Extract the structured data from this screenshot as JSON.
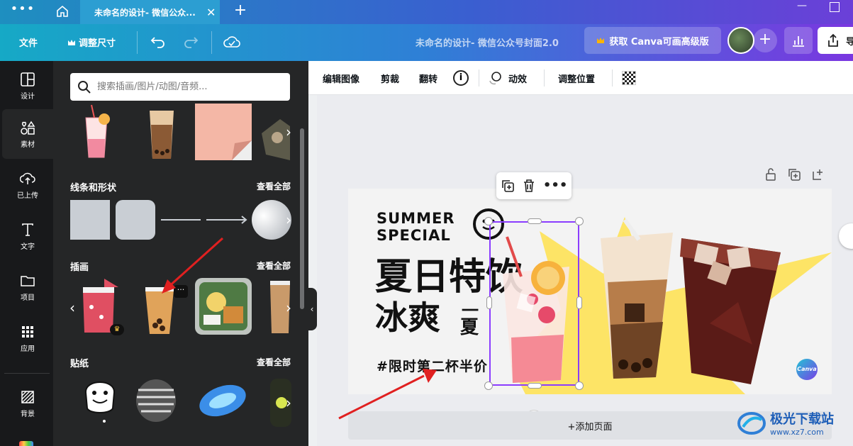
{
  "titlebar": {
    "menu": "•••",
    "tab_title": "未命名的设计- 微信公众...",
    "tab_close": "✕",
    "new_tab": "+"
  },
  "topbar": {
    "file": "文件",
    "resize": "调整尺寸",
    "doc_title": "未命名的设计- 微信公众号封面2.0",
    "upgrade": "获取 Canva可画高级版",
    "plus": "+"
  },
  "rail": {
    "items": [
      {
        "label": "设计",
        "icon": "layout-icon"
      },
      {
        "label": "素材",
        "icon": "elements-icon"
      },
      {
        "label": "已上传",
        "icon": "upload-icon"
      },
      {
        "label": "文字",
        "icon": "text-icon"
      },
      {
        "label": "项目",
        "icon": "folder-icon"
      },
      {
        "label": "应用",
        "icon": "apps-icon"
      },
      {
        "label": "背景",
        "icon": "background-icon"
      }
    ]
  },
  "panel": {
    "search_placeholder": "搜索插画/图片/动图/音频...",
    "sections": [
      {
        "title": "线条和形状",
        "see_all": "查看全部"
      },
      {
        "title": "插画",
        "see_all": "查看全部"
      },
      {
        "title": "贴纸",
        "see_all": "查看全部"
      }
    ]
  },
  "ctx_toolbar": {
    "edit_image": "编辑图像",
    "crop": "剪裁",
    "flip": "翻转",
    "animate": "动效",
    "position": "调整位置"
  },
  "design": {
    "summer_line1": "SUMMER",
    "summer_line2": "SPECIAL",
    "headline1": "夏日特饮",
    "headline2": "冰爽",
    "headline2_small_top": "一",
    "headline2_small_bottom": "夏",
    "promo": "#限时第二杯半价",
    "canva_badge": "Canva"
  },
  "canvas": {
    "add_page": "+添加页面"
  },
  "watermark": {
    "name": "极光下载站",
    "url": "www.xz7.com"
  },
  "colors": {
    "selection": "#8b3dff",
    "star": "#fde466",
    "arrow": "#e02020"
  }
}
